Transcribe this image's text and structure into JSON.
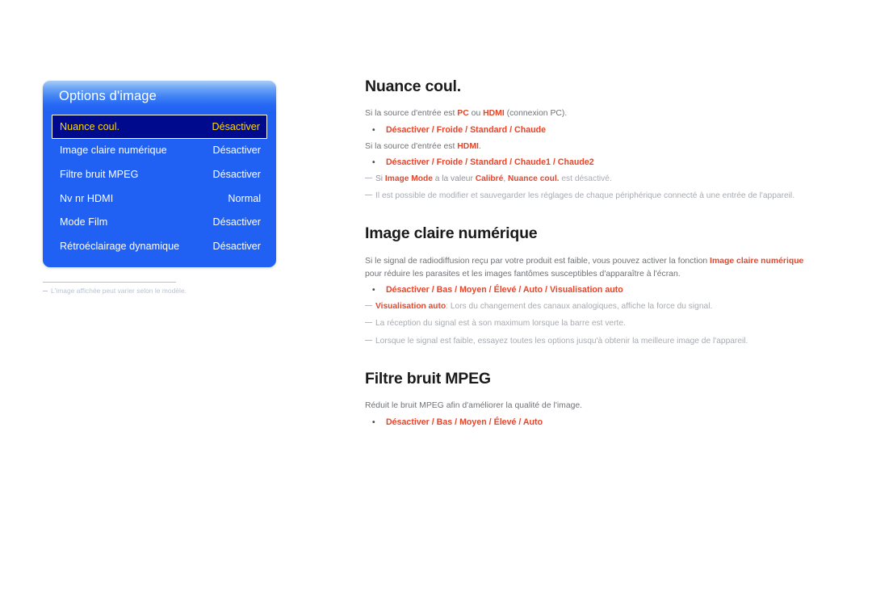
{
  "osd": {
    "title": "Options d'image",
    "rows": [
      {
        "label": "Nuance coul.",
        "value": "Désactiver",
        "selected": true
      },
      {
        "label": "Image claire numérique",
        "value": "Désactiver",
        "selected": false
      },
      {
        "label": "Filtre bruit MPEG",
        "value": "Désactiver",
        "selected": false
      },
      {
        "label": "Nv nr HDMI",
        "value": "Normal",
        "selected": false
      },
      {
        "label": "Mode Film",
        "value": "Désactiver",
        "selected": false
      },
      {
        "label": "Rétroéclairage dynamique",
        "value": "Désactiver",
        "selected": false
      }
    ],
    "footnote": "L'image affichée peut varier selon le modèle.",
    "colors": {
      "panel_blue": "#2060f2",
      "selected_navy": "#000a8c",
      "selected_text": "#ffd900",
      "row_text": "#ffffff"
    }
  },
  "sections": [
    {
      "heading": "Nuance coul.",
      "intro1_a": "Si la source d'entrée est ",
      "intro1_b": "PC",
      "intro1_c": " ou ",
      "intro1_d": "HDMI",
      "intro1_e": " (connexion PC).",
      "bullet1": "Désactiver / Froide / Standard / Chaude",
      "intro2_a": "Si la source d'entrée est ",
      "intro2_b": "HDMI",
      "intro2_c": ".",
      "bullet2": "Désactiver / Froide / Standard / Chaude1 / Chaude2",
      "note1_a": "Si ",
      "note1_b": "Image Mode",
      "note1_c": " a la valeur ",
      "note1_d": "Calibré",
      "note1_e": ", ",
      "note1_f": "Nuance coul.",
      "note1_g": " est désactivé.",
      "note2": "Il est possible de modifier et sauvegarder les réglages de chaque périphérique connecté à une entrée de l'appareil."
    },
    {
      "heading": "Image claire numérique",
      "para_a": "Si le signal de radiodiffusion reçu par votre produit est faible, vous pouvez activer la fonction ",
      "para_b": "Image claire numérique",
      "para_c": " pour réduire les parasites et les images fantômes susceptibles d'apparaître à l'écran.",
      "bullet1": "Désactiver / Bas / Moyen / Élevé / Auto / Visualisation auto",
      "note1_b": "Visualisation auto",
      "note1_c": ": Lors du changement des canaux analogiques, affiche la force du signal.",
      "note2": "La réception du signal est à son maximum lorsque la barre est verte.",
      "note3": "Lorsque le signal est faible, essayez toutes les options jusqu'à obtenir la meilleure image de l'appareil."
    },
    {
      "heading": "Filtre bruit MPEG",
      "para": "Réduit le bruit MPEG afin d'améliorer la qualité de l'image.",
      "bullet1": "Désactiver / Bas / Moyen / Élevé / Auto"
    }
  ],
  "bullet_glyph": "•",
  "accent_color": "#e8442a"
}
